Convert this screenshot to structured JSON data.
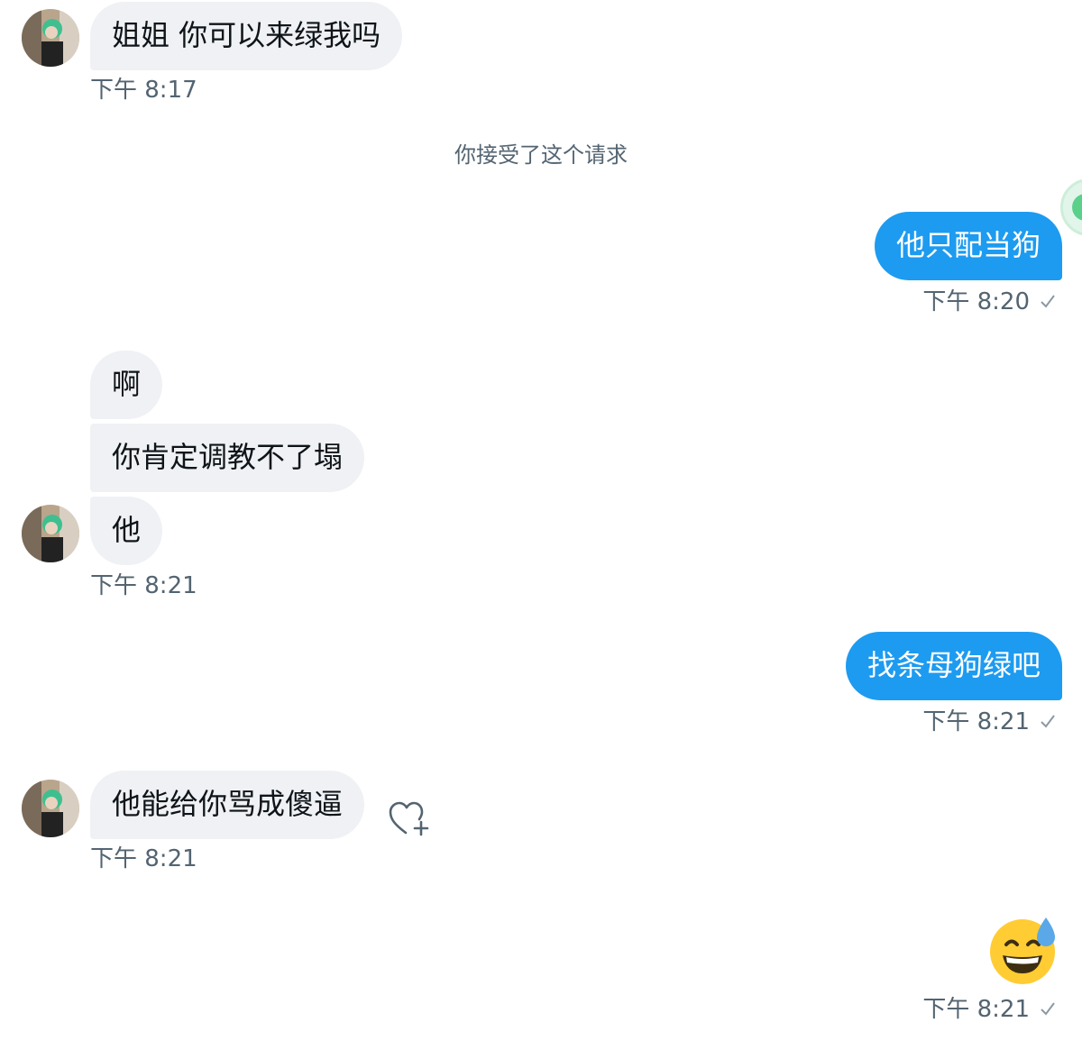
{
  "conversation": {
    "system_note": "你接受了这个请求",
    "messages": [
      {
        "side": "in",
        "text": "姐姐 你可以来绿我吗",
        "time": "下午 8:17"
      },
      {
        "side": "out",
        "text": "他只配当狗",
        "time": "下午 8:20"
      },
      {
        "side": "in",
        "text": "啊"
      },
      {
        "side": "in",
        "text": "你肯定调教不了塌"
      },
      {
        "side": "in",
        "text": "他",
        "time": "下午 8:21"
      },
      {
        "side": "out",
        "text": "找条母狗绿吧",
        "time": "下午 8:21"
      },
      {
        "side": "in",
        "text": "他能给你骂成傻逼",
        "time": "下午 8:21"
      },
      {
        "side": "out",
        "emoji": "grinning-face-with-sweat",
        "time": "下午 8:21"
      }
    ]
  },
  "colors": {
    "incoming_bubble": "#eff1f4",
    "outgoing_bubble": "#1d9bf0",
    "timestamp": "#536471"
  }
}
